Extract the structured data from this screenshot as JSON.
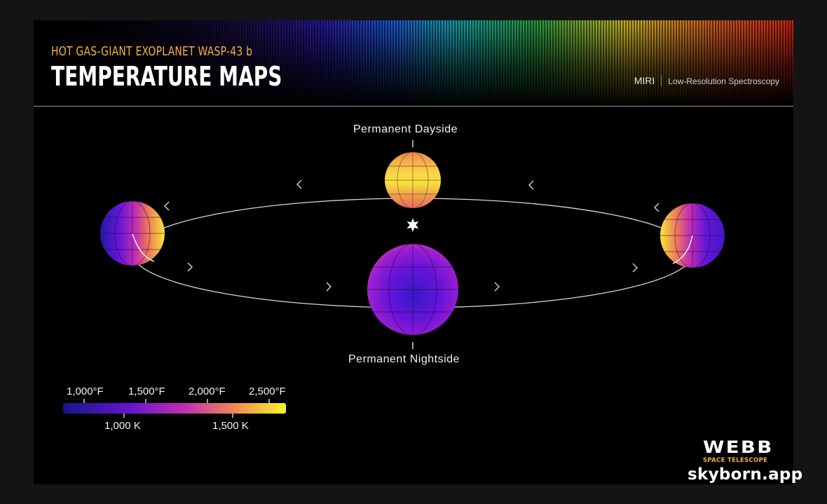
{
  "header": {
    "subtitle": "HOT GAS-GIANT EXOPLANET WASP-43 b",
    "title": "TEMPERATURE MAPS",
    "instrument": "MIRI",
    "mode": "Low-Resolution Spectroscopy"
  },
  "diagram": {
    "dayside_label": "Permanent Dayside",
    "nightside_label": "Permanent Nightside"
  },
  "colors": {
    "cold": "#1a1a8c",
    "mid": "#8a18d0",
    "warm": "#e8577a",
    "hot": "#f5a048",
    "hottest": "#f8f82a",
    "accent": "#f2b33d"
  },
  "scale": {
    "fahrenheit": [
      "1,000°F",
      "1,500°F",
      "2,000°F",
      "2,500°F"
    ],
    "kelvin": [
      "1,000 K",
      "1,500 K"
    ]
  },
  "branding": {
    "logo_word": "WEBB",
    "logo_sub": "SPACE TELESCOPE",
    "watermark": "skyborn.app"
  }
}
